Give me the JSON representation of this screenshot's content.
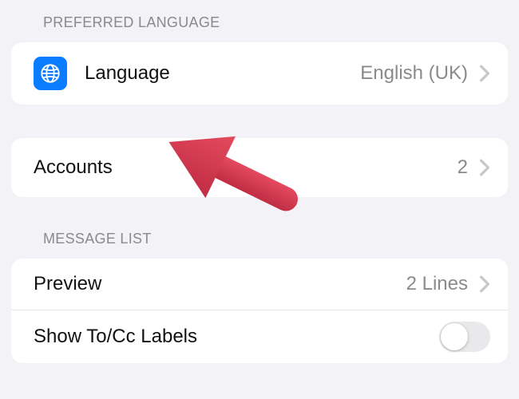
{
  "sections": {
    "preferred_language": {
      "header": "PREFERRED LANGUAGE",
      "language_row": {
        "label": "Language",
        "value": "English (UK)"
      }
    },
    "accounts": {
      "row": {
        "label": "Accounts",
        "value": "2"
      }
    },
    "message_list": {
      "header": "MESSAGE LIST",
      "preview_row": {
        "label": "Preview",
        "value": "2 Lines"
      },
      "show_tocc_row": {
        "label": "Show To/Cc Labels",
        "on": false
      }
    }
  },
  "annotation": {
    "arrow_points_to": "accounts-row",
    "color": "#d53b50"
  }
}
